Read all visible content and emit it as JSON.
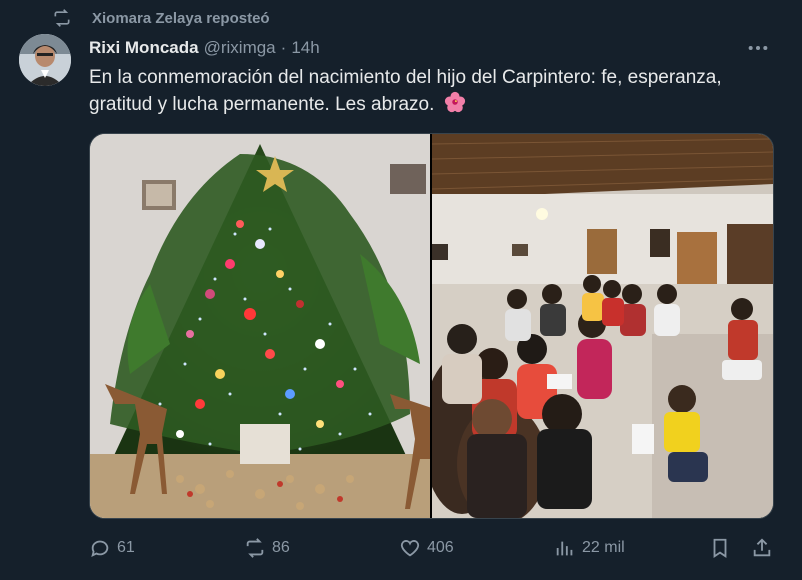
{
  "repost": {
    "text": "Xiomara Zelaya reposteó",
    "icon": "repost-icon"
  },
  "tweet": {
    "author_name": "Rixi Moncada",
    "handle": "@riximga",
    "separator": "·",
    "time": "14h",
    "text": "En la conmemoración del nacimiento del hijo del Carpintero: fe, esperanza, gratitud y lucha permanente. Les abrazo.",
    "emoji": "hibiscus-icon"
  },
  "media": [
    {
      "name": "photo-christmas-tree",
      "alt": ""
    },
    {
      "name": "photo-gathering",
      "alt": ""
    }
  ],
  "actions": {
    "replies": "61",
    "reposts": "86",
    "likes": "406",
    "views": "22 mil"
  },
  "colors": {
    "background": "#15202b",
    "text": "#e7e9ea",
    "secondary": "#8b98a5",
    "border": "#38444d"
  }
}
